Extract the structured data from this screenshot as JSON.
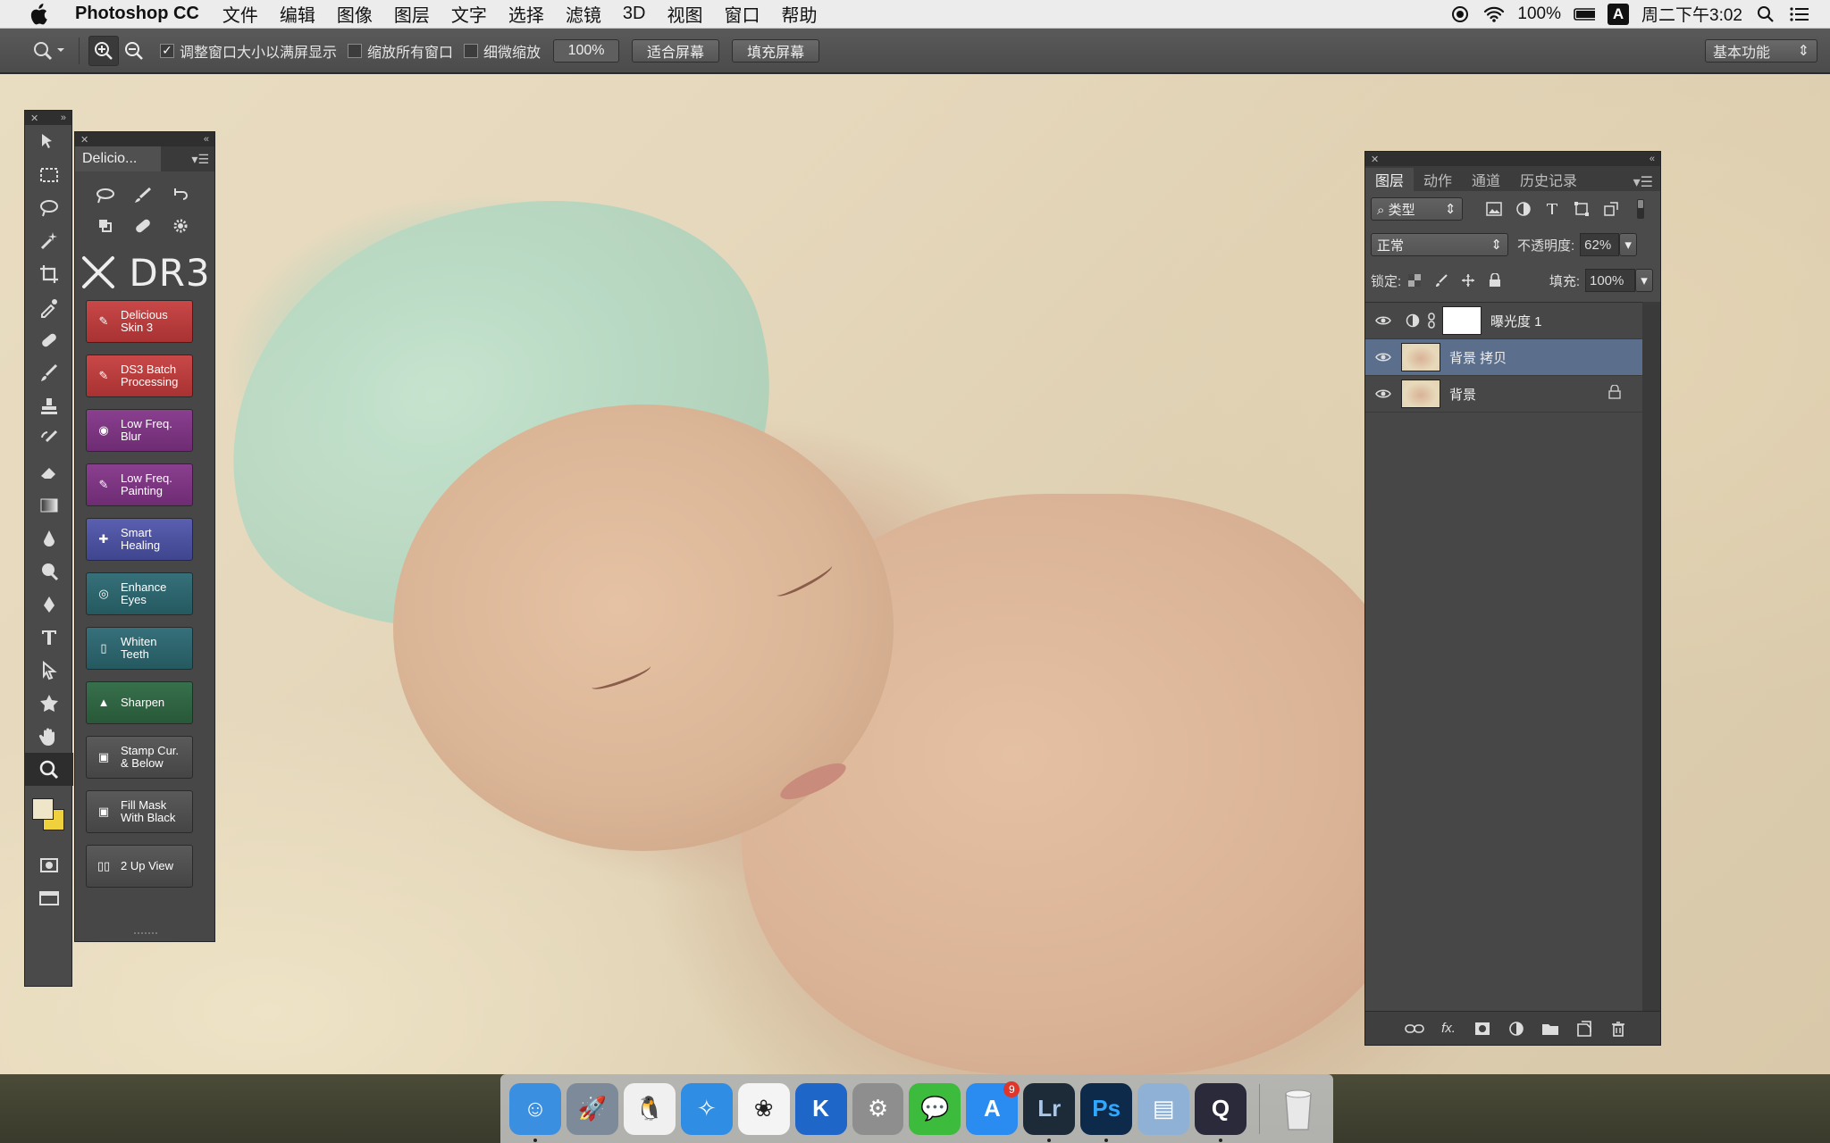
{
  "menubar": {
    "app_name": "Photoshop CC",
    "items": [
      "文件",
      "编辑",
      "图像",
      "图层",
      "文字",
      "选择",
      "滤镜",
      "3D",
      "视图",
      "窗口",
      "帮助"
    ],
    "battery": "100%",
    "input_method": "A",
    "clock": "周二下午3:02"
  },
  "options_bar": {
    "resize_windows_label": "调整窗口大小以满屏显示",
    "zoom_all_label": "缩放所有窗口",
    "scrubby_label": "细微缩放",
    "zoom_percent": "100%",
    "fit_screen_label": "适合屏幕",
    "fill_screen_label": "填充屏幕",
    "workspace": "基本功能"
  },
  "delicious_panel": {
    "tab": "Delicio...",
    "logo_text": "DR3",
    "buttons": [
      {
        "line1": "Delicious",
        "line2": "Skin 3",
        "color": "red"
      },
      {
        "line1": "DS3 Batch",
        "line2": "Processing",
        "color": "red"
      },
      {
        "line1": "Low Freq.",
        "line2": "Blur",
        "color": "purple"
      },
      {
        "line1": "Low Freq.",
        "line2": "Painting",
        "color": "purple"
      },
      {
        "line1": "Smart",
        "line2": "Healing",
        "color": "blue"
      },
      {
        "line1": "Enhance",
        "line2": "Eyes",
        "color": "teal"
      },
      {
        "line1": "Whiten",
        "line2": "Teeth",
        "color": "teal"
      },
      {
        "line1": "Sharpen",
        "line2": "",
        "color": "green"
      },
      {
        "line1": "Stamp Cur.",
        "line2": "& Below",
        "color": "gray"
      },
      {
        "line1": "Fill Mask",
        "line2": "With Black",
        "color": "gray"
      },
      {
        "line1": "2 Up View",
        "line2": "",
        "color": "gray"
      }
    ]
  },
  "layers_panel": {
    "tabs": [
      "图层",
      "动作",
      "通道",
      "历史记录"
    ],
    "filter_kind": "类型",
    "blend_mode": "正常",
    "opacity_label": "不透明度:",
    "opacity_value": "62%",
    "lock_label": "锁定:",
    "fill_label": "填充:",
    "fill_value": "100%",
    "layers": [
      {
        "name": "曝光度 1",
        "type": "adjustment",
        "selected": false
      },
      {
        "name": "背景 拷贝",
        "type": "pixel",
        "selected": true
      },
      {
        "name": "背景",
        "type": "background",
        "selected": false
      }
    ],
    "footer_fx": "fx."
  },
  "dock": {
    "apps": [
      {
        "name": "Finder",
        "color": "#3b8fe0"
      },
      {
        "name": "Launchpad",
        "color": "#7c8a99"
      },
      {
        "name": "QQ",
        "color": "#f0f0f0"
      },
      {
        "name": "Safari",
        "color": "#2f8de4"
      },
      {
        "name": "Photos",
        "color": "#f4f4f4"
      },
      {
        "name": "Kuaibo",
        "color": "#1f66c9"
      },
      {
        "name": "System Preferences",
        "color": "#8e8e8e"
      },
      {
        "name": "WeChat",
        "color": "#3dbb3d"
      },
      {
        "name": "App Store",
        "color": "#2a8cf0"
      },
      {
        "name": "Lightroom",
        "color": "#1d2a38",
        "label": "Lr"
      },
      {
        "name": "Photoshop",
        "color": "#0d2a4a",
        "label": "Ps"
      },
      {
        "name": "Preview",
        "color": "#8fb1d6"
      },
      {
        "name": "QuickTime",
        "color": "#2a2a3a"
      }
    ],
    "appstore_badge": "9"
  },
  "colors": {
    "accent_selection": "#5b6f8d",
    "foreground": "#efe6c9",
    "background": "#efd03d"
  }
}
